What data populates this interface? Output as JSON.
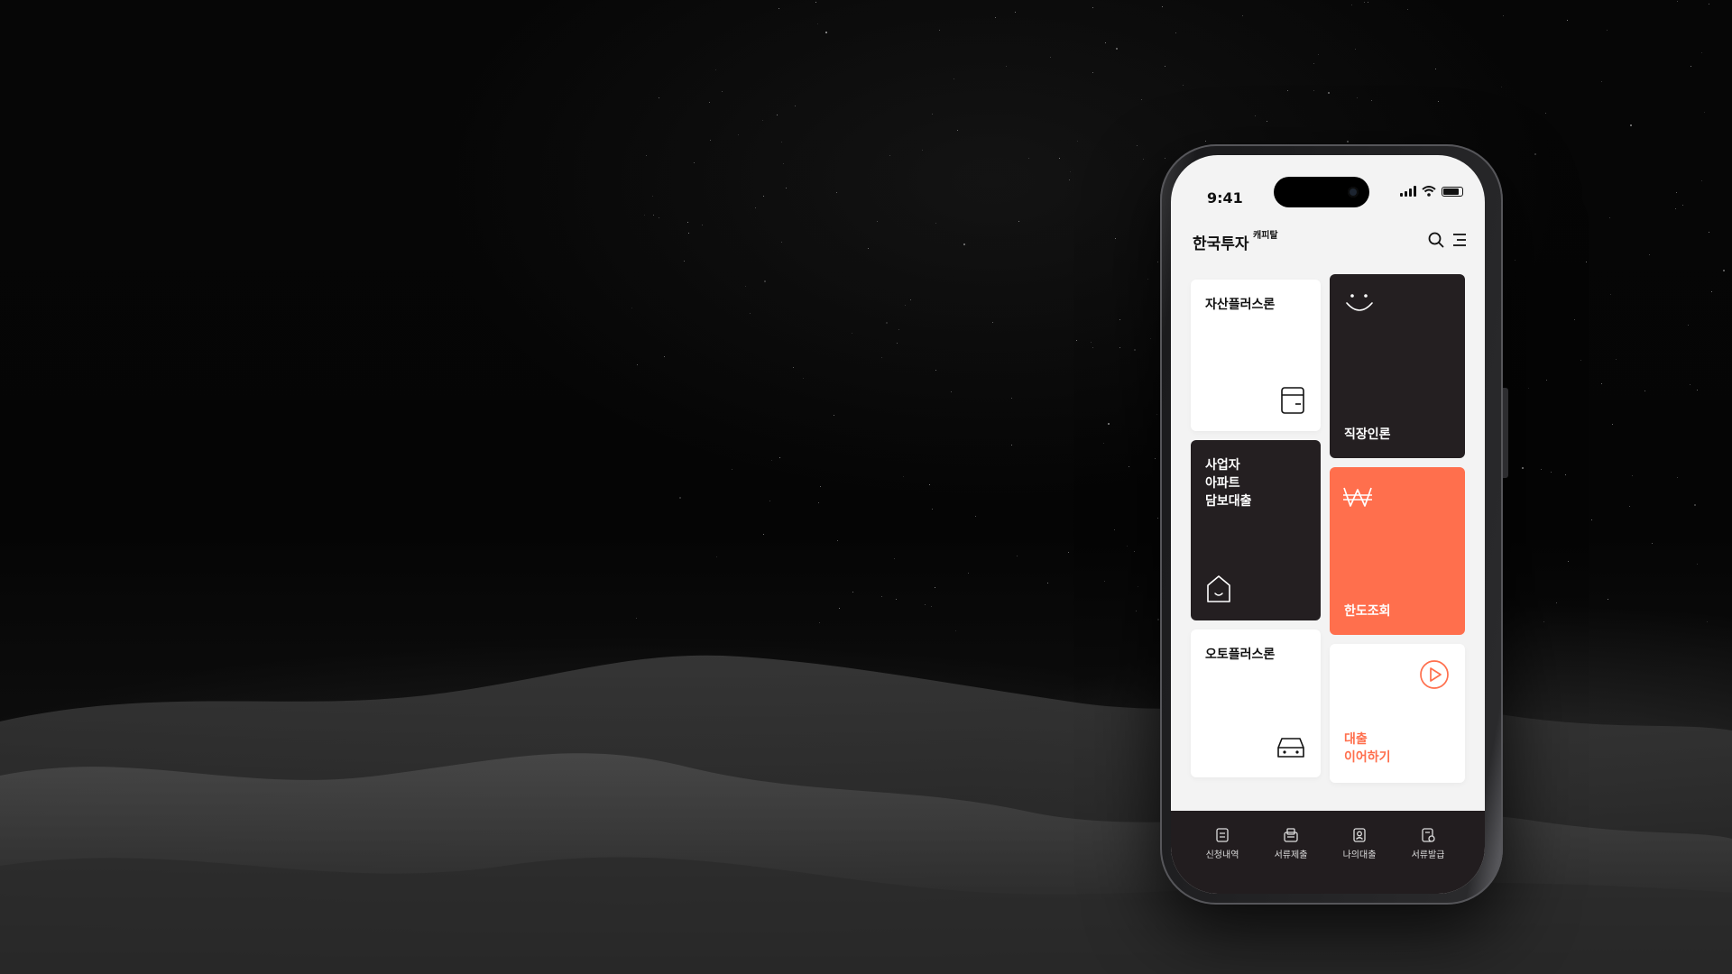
{
  "status_bar": {
    "time": "9:41"
  },
  "app_bar": {
    "brand": "한국투자",
    "brand_sub": "캐피탈",
    "icons": [
      "search-icon",
      "menu-icon"
    ]
  },
  "tiles": [
    {
      "label": "자산플러스론",
      "icon": "wallet-icon",
      "theme": "white"
    },
    {
      "label": "직장인론",
      "icon": "smile-icon",
      "theme": "dark"
    },
    {
      "lines": [
        "사업자",
        "아파트",
        "담보대출"
      ],
      "icon": "house-icon",
      "theme": "dark"
    },
    {
      "label": "한도조회",
      "icon": "won-icon",
      "theme": "orange"
    },
    {
      "label": "오토플러스론",
      "icon": "car-icon",
      "theme": "white"
    },
    {
      "lines": [
        "대출",
        "이어하기"
      ],
      "icon": "play-circle-icon",
      "theme": "white-accent"
    }
  ],
  "tab_bar": [
    {
      "label": "신청내역",
      "icon": "list-doc-icon"
    },
    {
      "label": "서류제출",
      "icon": "upload-doc-icon"
    },
    {
      "label": "나의대출",
      "icon": "profile-card-icon"
    },
    {
      "label": "서류발급",
      "icon": "issue-doc-icon"
    }
  ],
  "colors": {
    "accent": "#ff6f4d",
    "dark_tile": "#241f21",
    "screen_bg": "#f3f3f3"
  }
}
